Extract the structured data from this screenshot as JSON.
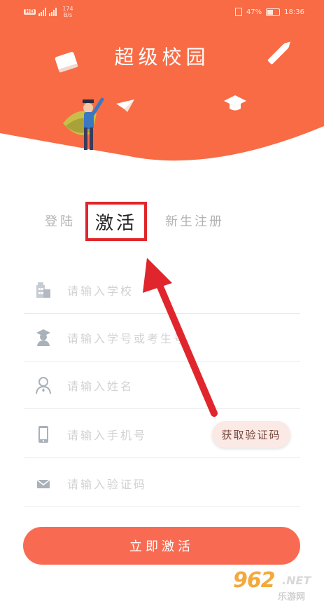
{
  "status_bar": {
    "hd_badge": "HD",
    "speed_value": "174",
    "speed_unit": "B/s",
    "battery": "47%",
    "time": "18:36"
  },
  "header": {
    "title": "超级校园",
    "bg_color": "#f86b45"
  },
  "tabs": [
    {
      "label": "登陆",
      "active": false
    },
    {
      "label": "激活",
      "active": true
    },
    {
      "label": "新生注册",
      "active": false
    }
  ],
  "form": {
    "school_placeholder": "请输入学校",
    "student_id_placeholder": "请输入学号或考生号",
    "name_placeholder": "请输入姓名",
    "phone_placeholder": "请输入手机号",
    "code_placeholder": "请输入验证码",
    "get_code_label": "获取验证码"
  },
  "submit": {
    "label": "立即激活",
    "color": "#f86b52"
  },
  "annotation": {
    "highlight_color": "#e0262c"
  },
  "watermark": {
    "digits": "962",
    "suffix": ".NET",
    "sub": "乐游网"
  },
  "icons": [
    "edit-icon",
    "book-icon",
    "paper-plane-icon",
    "graduation-cap-icon",
    "school-building-icon",
    "student-icon",
    "person-icon",
    "phone-icon",
    "mail-icon"
  ]
}
